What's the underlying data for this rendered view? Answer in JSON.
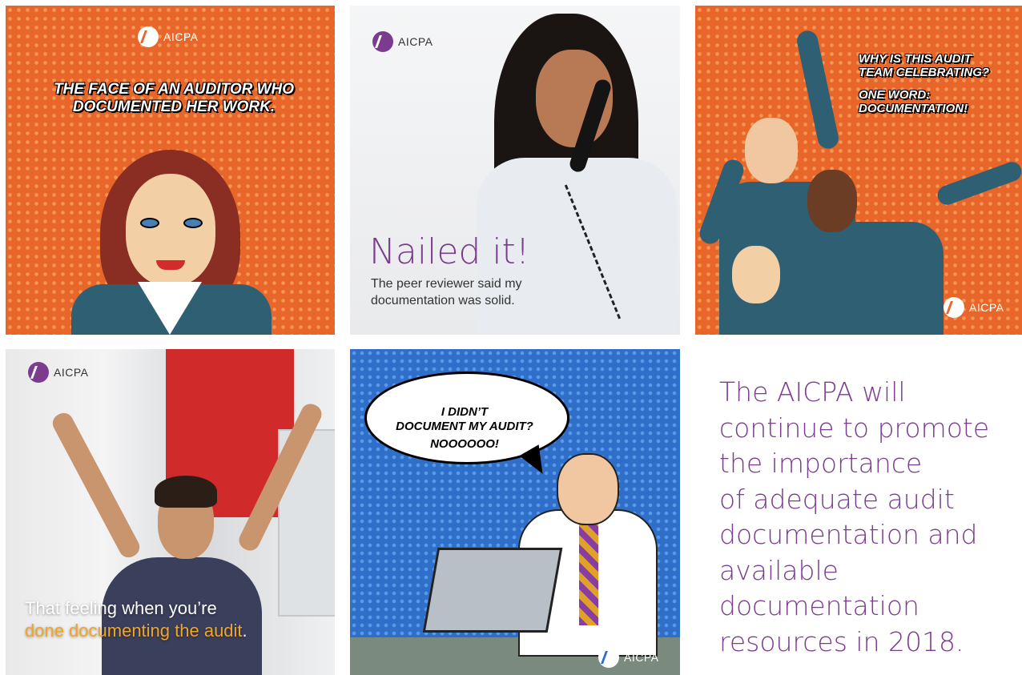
{
  "brand": {
    "name": "AICPA",
    "colors": {
      "orange": "#e8662a",
      "purple": "#7b3b8e",
      "blue": "#2f6fc9",
      "highlight": "#f2a524"
    }
  },
  "tiles": [
    {
      "caption_line1": "THE FACE OF AN AUDITOR WHO",
      "caption_line2": "DOCUMENTED HER WORK."
    },
    {
      "headline": "Nailed it!",
      "caption": "The peer reviewer said my documentation was solid."
    },
    {
      "caption_line1": "WHY IS THIS AUDIT",
      "caption_line2": "TEAM CELEBRATING?",
      "caption_line3": "ONE WORD:",
      "caption_line4": "DOCUMENTATION!"
    },
    {
      "caption_line1": "That feeling when you’re",
      "caption_highlight": "done documenting the audit",
      "caption_end": "."
    },
    {
      "bubble_line1": "I DIDN’T",
      "bubble_line2": "DOCUMENT MY AUDIT?",
      "bubble_line3": "NOOOOOO!"
    }
  ],
  "closing": {
    "line1": "The AICPA will",
    "line2": "continue to promote",
    "line3": "the importance",
    "line4": "of adequate audit",
    "line5": "documentation and",
    "line6": "available documentation",
    "line7": "resources in 2018."
  }
}
